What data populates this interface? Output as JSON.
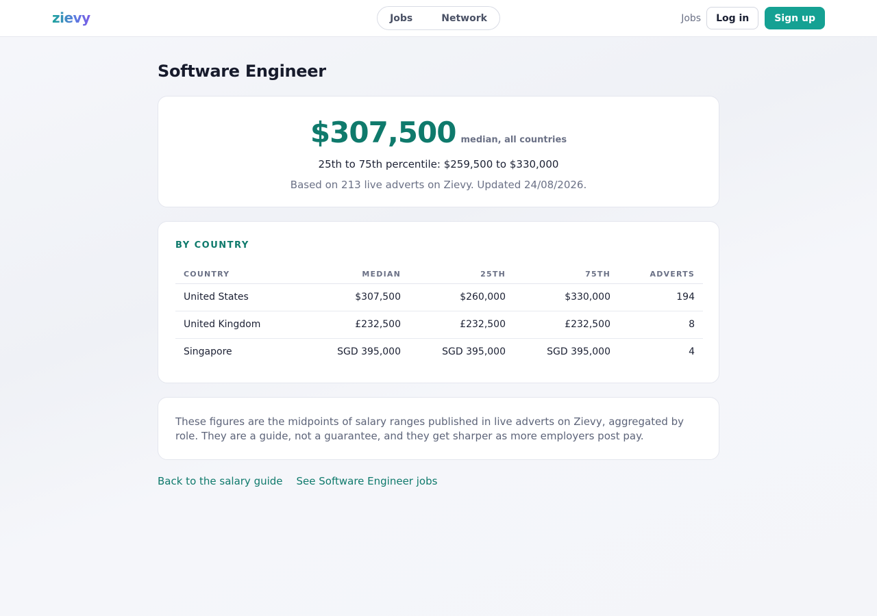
{
  "header": {
    "logo": "zievy",
    "center_nav": [
      "Jobs",
      "Network"
    ],
    "right_jobs_link": "Jobs",
    "login_label": "Log in",
    "signup_label": "Sign up"
  },
  "page": {
    "title": "Software Engineer"
  },
  "summary": {
    "median_value": "$307,500",
    "median_caption": "median, all countries",
    "percentile_line": "25th to 75th percentile: $259,500 to $330,000",
    "based_line": "Based on 213 live adverts on Zievy. Updated 24/08/2026."
  },
  "by_country": {
    "title": "BY COUNTRY",
    "columns": [
      "COUNTRY",
      "MEDIAN",
      "25TH",
      "75TH",
      "ADVERTS"
    ],
    "rows": [
      [
        "United States",
        "$307,500",
        "$260,000",
        "$330,000",
        "194"
      ],
      [
        "United Kingdom",
        "£232,500",
        "£232,500",
        "£232,500",
        "8"
      ],
      [
        "Singapore",
        "SGD 395,000",
        "SGD 395,000",
        "SGD 395,000",
        "4"
      ]
    ]
  },
  "note": {
    "text": "These figures are the midpoints of salary ranges published in live adverts on Zievy, aggregated by role. They are a guide, not a guarantee, and they get sharper as more employers post pay."
  },
  "links": {
    "back": "Back to the salary guide",
    "see_jobs": "See Software Engineer jobs"
  },
  "colors": {
    "brand": "#15a193",
    "accent_text": "#0f7a6c"
  }
}
